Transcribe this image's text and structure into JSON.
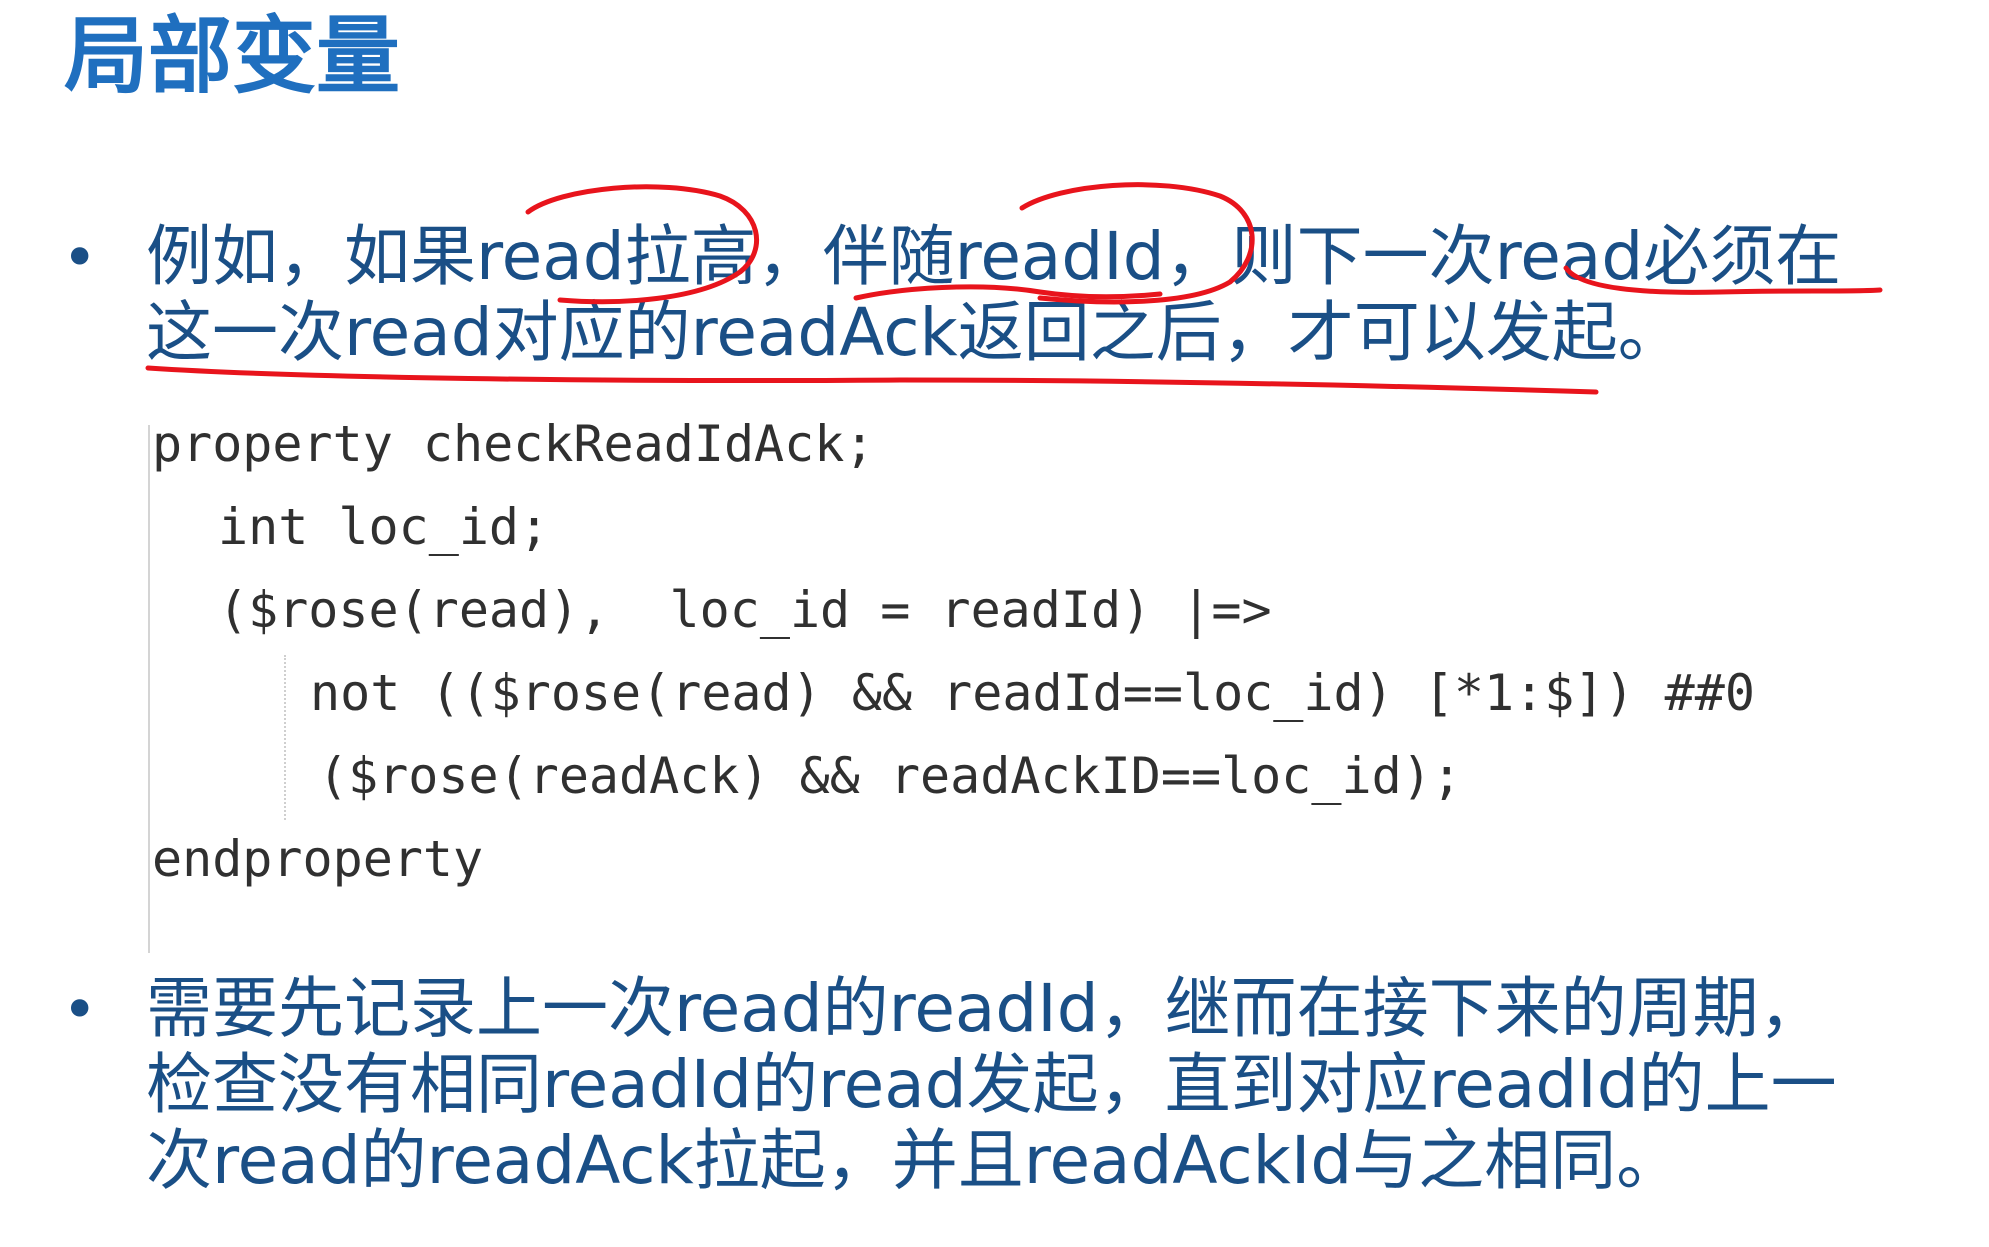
{
  "title": "局部变量",
  "bullets": [
    {
      "line1": "例如，如果read拉高，伴随readId，则下一次read必须在",
      "line2": "这一次read对应的readAck返回之后，才可以发起。"
    },
    {
      "line1": "需要先记录上一次read的readId，继而在接下来的周期，",
      "line2": "检查没有相同readId的read发起，直到对应readId的上一",
      "line3": "次read的readAck拉起，并且readAckId与之相同。"
    }
  ],
  "code": {
    "l1": "property checkReadIdAck;",
    "l2": "int loc_id;",
    "l3": "($rose(read),  loc_id = readId) |=>",
    "l4": "not (($rose(read) && readId==loc_id) [*1:$]) ##0",
    "l5": "($rose(readAck) && readAckID==loc_id);",
    "l6": "endproperty"
  },
  "colors": {
    "title": "#1f6fbf",
    "text": "#1a4f86",
    "code": "#303030",
    "annotation": "#e8141c"
  }
}
